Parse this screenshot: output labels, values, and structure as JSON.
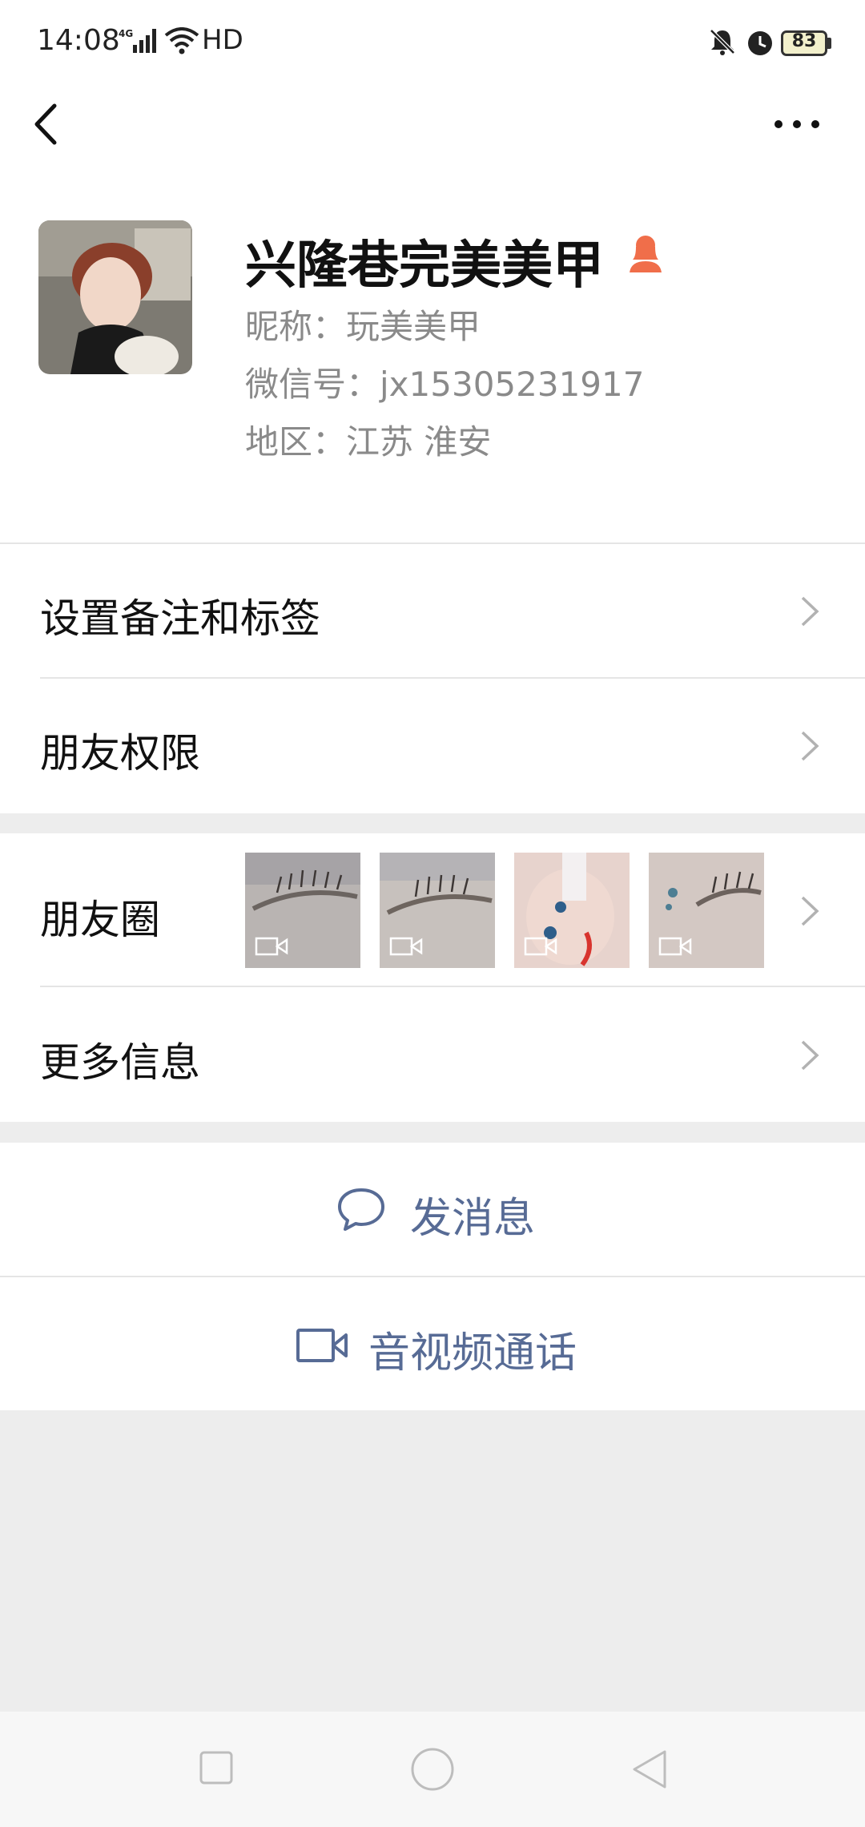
{
  "status_bar": {
    "time": "14:08",
    "network": "4G",
    "hd": "HD",
    "battery": "83",
    "icons": [
      "signal-icon",
      "wifi-icon",
      "mute-icon",
      "alarm-icon",
      "battery-icon"
    ]
  },
  "header": {
    "back_icon": "back-arrow-icon",
    "more_icon": "more-dots-icon"
  },
  "profile": {
    "name": "兴隆巷完美美甲",
    "gender_icon": "female-icon",
    "nickname": "昵称：玩美美甲",
    "wechat_id": "微信号：jx15305231917",
    "region": "地区：江苏  淮安"
  },
  "menu": {
    "remark_tags": "设置备注和标签",
    "friend_permissions": "朋友权限",
    "moments": "朋友圈",
    "more_info": "更多信息"
  },
  "moments_thumbnails": [
    {
      "type": "video"
    },
    {
      "type": "video"
    },
    {
      "type": "video"
    },
    {
      "type": "video"
    }
  ],
  "actions": {
    "send_message": "发消息",
    "video_call": "音视频通话"
  },
  "colors": {
    "link": "#576b95",
    "gender": "#f06e4a",
    "background": "#ededed"
  }
}
